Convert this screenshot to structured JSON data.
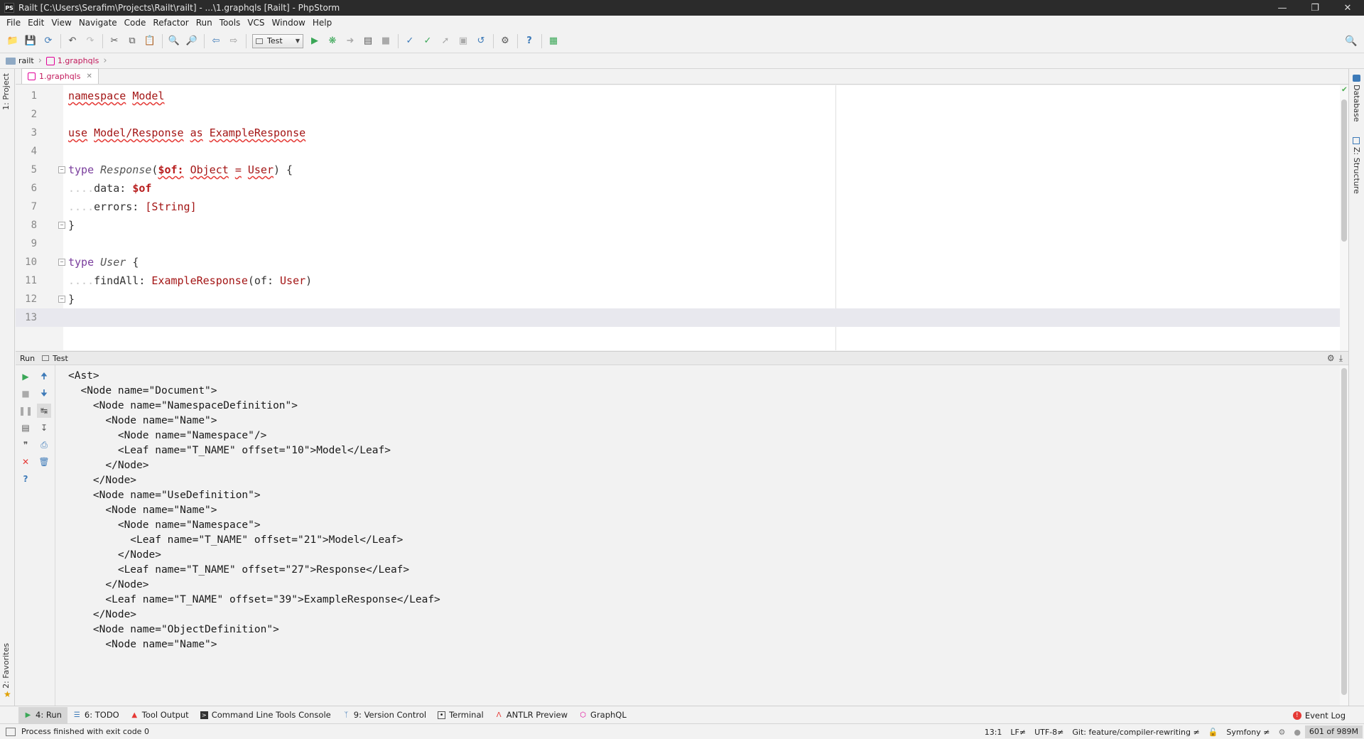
{
  "window": {
    "app_icon": "PS",
    "title": "Railt [C:\\Users\\Serafim\\Projects\\Railt\\railt] - ...\\1.graphqls [Railt] - PhpStorm"
  },
  "menu": [
    "File",
    "Edit",
    "View",
    "Navigate",
    "Code",
    "Refactor",
    "Run",
    "Tools",
    "VCS",
    "Window",
    "Help"
  ],
  "toolbar": {
    "run_config_label": "Test"
  },
  "breadcrumb": {
    "project": "railt",
    "file": "1.graphqls"
  },
  "left_panel_tabs": {
    "project": "1: Project",
    "favorites": "2: Favorites"
  },
  "right_panel_tabs": {
    "database": "Database",
    "structure": "Z: Structure"
  },
  "editor": {
    "tab_label": "1.graphqls",
    "line_numbers": [
      "1",
      "2",
      "3",
      "4",
      "5",
      "6",
      "7",
      "8",
      "9",
      "10",
      "11",
      "12",
      "13"
    ],
    "code": {
      "l1_kw": "namespace",
      "l1_id": "Model",
      "l3_kw": "use",
      "l3_path": "Model/Response",
      "l3_as": "as",
      "l3_alias": "ExampleResponse",
      "l5_kw": "type",
      "l5_name": "Response",
      "l5_paren_open": "(",
      "l5_arg": "$of:",
      "l5_argtype": "Object",
      "l5_eq": "=",
      "l5_default": "User",
      "l5_close": ") {",
      "l6_field": "data:",
      "l6_value": "$of",
      "l7_field": "errors:",
      "l7_value": "[String]",
      "l8_brace": "}",
      "l10_kw": "type",
      "l10_name": "User",
      "l10_brace": "{",
      "l11_field": "findAll:",
      "l11_type": "ExampleResponse",
      "l11_args": "(of:",
      "l11_argtype": "User",
      "l11_close": ")",
      "l12_brace": "}"
    }
  },
  "run_panel": {
    "label": "Run",
    "config": "Test",
    "console_lines": [
      "<Ast>",
      "  <Node name=\"Document\">",
      "    <Node name=\"NamespaceDefinition\">",
      "      <Node name=\"Name\">",
      "        <Node name=\"Namespace\"/>",
      "        <Leaf name=\"T_NAME\" offset=\"10\">Model</Leaf>",
      "      </Node>",
      "    </Node>",
      "    <Node name=\"UseDefinition\">",
      "      <Node name=\"Name\">",
      "        <Node name=\"Namespace\">",
      "          <Leaf name=\"T_NAME\" offset=\"21\">Model</Leaf>",
      "        </Node>",
      "        <Leaf name=\"T_NAME\" offset=\"27\">Response</Leaf>",
      "      </Node>",
      "      <Leaf name=\"T_NAME\" offset=\"39\">ExampleResponse</Leaf>",
      "    </Node>",
      "    <Node name=\"ObjectDefinition\">",
      "      <Node name=\"Name\">"
    ]
  },
  "bottom_tabs": [
    {
      "label": "4: Run",
      "icon": "run-icon"
    },
    {
      "label": "6: TODO",
      "icon": "todo-icon"
    },
    {
      "label": "Tool Output",
      "icon": "tool-output-icon"
    },
    {
      "label": "Command Line Tools Console",
      "icon": "console-icon"
    },
    {
      "label": "9: Version Control",
      "icon": "vcs-icon"
    },
    {
      "label": "Terminal",
      "icon": "terminal-icon"
    },
    {
      "label": "ANTLR Preview",
      "icon": "antlr-icon"
    },
    {
      "label": "GraphQL",
      "icon": "graphql-icon"
    }
  ],
  "event_log": "Event Log",
  "status": {
    "message": "Process finished with exit code 0",
    "position": "13:1",
    "line_sep": "LF≠",
    "encoding": "UTF-8≠",
    "git": "Git: feature/compiler-rewriting ≠",
    "framework": "Symfony ≠",
    "memory": "601 of 989M"
  },
  "colors": {
    "titlebar": "#2b2b2b",
    "keyword": "#000080",
    "identifier": "#a31515",
    "graphql_accent": "#e10098"
  }
}
